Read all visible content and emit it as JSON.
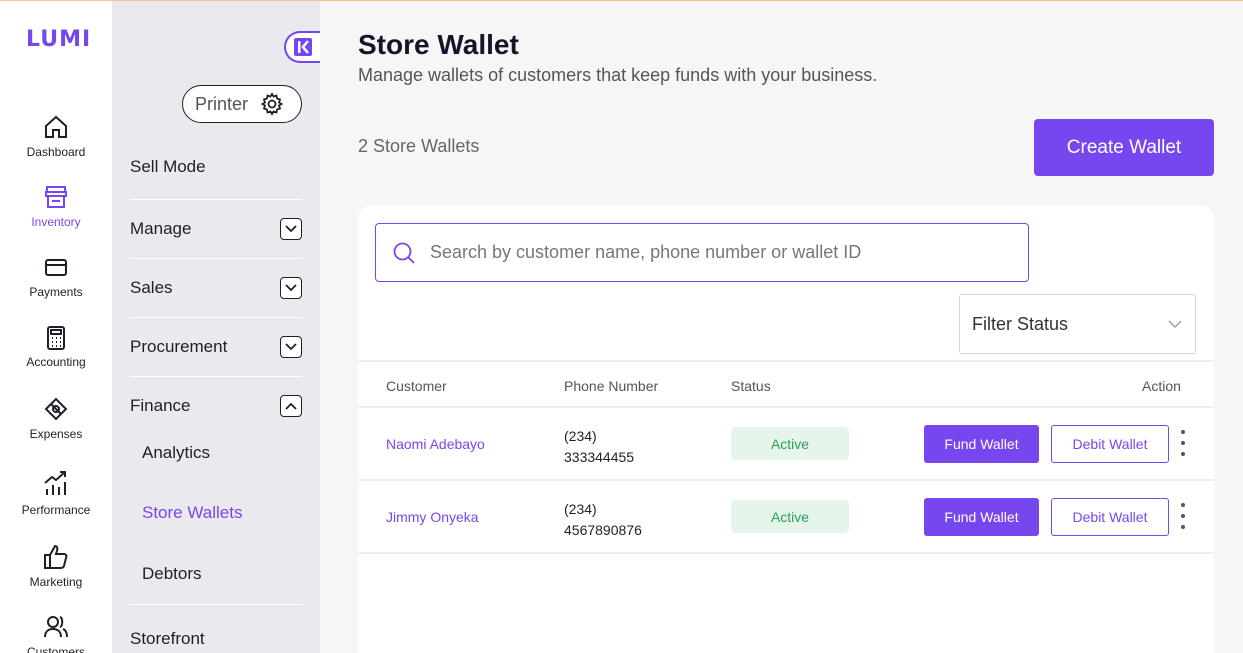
{
  "app": {
    "logo": "LUMI",
    "accent": "#7647ee"
  },
  "rail": {
    "items": [
      {
        "label": "Dashboard",
        "icon": "home-icon"
      },
      {
        "label": "Inventory",
        "icon": "store-icon",
        "active": true
      },
      {
        "label": "Payments",
        "icon": "card-icon"
      },
      {
        "label": "Accounting",
        "icon": "calculator-icon"
      },
      {
        "label": "Expenses",
        "icon": "money-tag-icon"
      },
      {
        "label": "Performance",
        "icon": "chart-up-icon"
      },
      {
        "label": "Marketing",
        "icon": "thumbs-up-icon"
      },
      {
        "label": "Customers",
        "icon": "users-icon"
      }
    ]
  },
  "sidebar": {
    "printer_label": "Printer",
    "sell_mode": "Sell Mode",
    "sections": [
      {
        "label": "Manage",
        "expanded": false
      },
      {
        "label": "Sales",
        "expanded": false
      },
      {
        "label": "Procurement",
        "expanded": false
      },
      {
        "label": "Finance",
        "expanded": true
      }
    ],
    "finance_items": [
      {
        "label": "Analytics"
      },
      {
        "label": "Store Wallets",
        "active": true
      },
      {
        "label": "Debtors"
      }
    ],
    "storefront": "Storefront"
  },
  "main": {
    "title": "Store Wallet",
    "subtitle": "Manage wallets of customers that keep funds with your business.",
    "count": "2 Store Wallets",
    "create_button": "Create Wallet",
    "search_placeholder": "Search by customer name, phone number or wallet ID",
    "filter_label": "Filter Status",
    "columns": [
      "Customer",
      "Phone Number",
      "Status",
      "Action"
    ],
    "rows": [
      {
        "customer": "Naomi Adebayo",
        "phone_code": "(234)",
        "phone": "333344455",
        "status": "Active",
        "fund": "Fund Wallet",
        "debit": "Debit Wallet"
      },
      {
        "customer": "Jimmy Onyeka",
        "phone_code": "(234)",
        "phone": "4567890876",
        "status": "Active",
        "fund": "Fund Wallet",
        "debit": "Debit Wallet"
      }
    ]
  }
}
